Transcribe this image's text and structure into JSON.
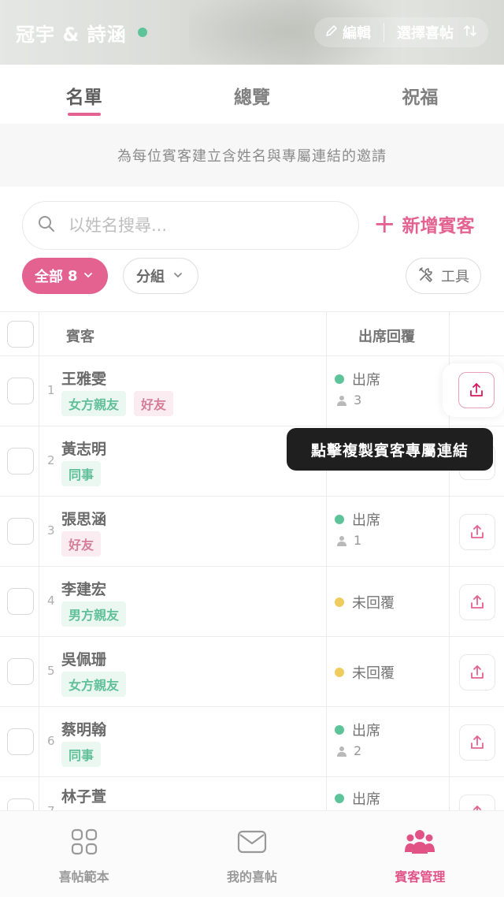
{
  "header": {
    "couple_name": "冠宇 & 詩涵",
    "edit_label": "編輯",
    "select_invitation_label": "選擇喜帖"
  },
  "tabs": [
    {
      "label": "名單",
      "active": true
    },
    {
      "label": "總覽",
      "active": false
    },
    {
      "label": "祝福",
      "active": false
    }
  ],
  "info_text": "為每位賓客建立含姓名與專屬連結的邀請",
  "search": {
    "placeholder": "以姓名搜尋..."
  },
  "add_guest_label": "新增賓客",
  "filters": {
    "all_label": "全部",
    "all_count": "8",
    "group_label": "分組",
    "tools_label": "工具"
  },
  "table": {
    "col_guest": "賓客",
    "col_rsvp": "出席回覆",
    "rows": [
      {
        "num": "1",
        "name": "王雅雯",
        "tags": [
          "女方親友",
          "好友"
        ],
        "status": "出席",
        "status_color": "#11a86b",
        "count": "3"
      },
      {
        "num": "2",
        "name": "黃志明",
        "tags": [
          "同事"
        ],
        "status": "",
        "status_color": "",
        "count": ""
      },
      {
        "num": "3",
        "name": "張思涵",
        "tags": [
          "好友"
        ],
        "status": "出席",
        "status_color": "#11a86b",
        "count": "1"
      },
      {
        "num": "4",
        "name": "李建宏",
        "tags": [
          "男方親友"
        ],
        "status": "未回覆",
        "status_color": "#e8b50f",
        "count": ""
      },
      {
        "num": "5",
        "name": "吳佩珊",
        "tags": [
          "女方親友"
        ],
        "status": "未回覆",
        "status_color": "#e8b50f",
        "count": ""
      },
      {
        "num": "6",
        "name": "蔡明翰",
        "tags": [
          "同事"
        ],
        "status": "出席",
        "status_color": "#11a86b",
        "count": "2"
      },
      {
        "num": "7",
        "name": "林子萱",
        "tags": [],
        "status": "出席",
        "status_color": "#11a86b",
        "count": ""
      }
    ]
  },
  "tooltip": "點擊複製賓客專屬連結",
  "bottom_nav": [
    {
      "label": "喜帖範本",
      "icon": "grid-icon",
      "active": false
    },
    {
      "label": "我的喜帖",
      "icon": "envelope-icon",
      "active": false
    },
    {
      "label": "賓客管理",
      "icon": "guests-icon",
      "active": true
    }
  ],
  "colors": {
    "accent": "#d7195c",
    "attend": "#11a86b",
    "pending": "#e8b50f",
    "tag_green": "#17a36a",
    "tag_pink": "#c2416b"
  }
}
